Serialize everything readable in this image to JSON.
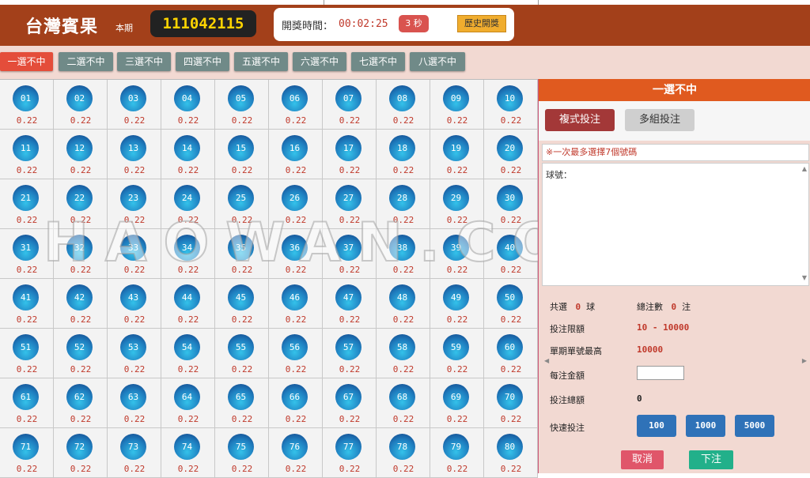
{
  "header": {
    "title": "台灣賓果",
    "period_label": "本期",
    "period_number": "111042115",
    "draw_time_label": "開獎時間：",
    "draw_time_value": "00:02:25",
    "countdown_label": "3 秒",
    "history_label": "歷史開獎"
  },
  "tabs": [
    "一選不中",
    "二選不中",
    "三選不中",
    "四選不中",
    "五選不中",
    "六選不中",
    "七選不中",
    "八選不中"
  ],
  "active_tab": 0,
  "grid": {
    "numbers": [
      "01",
      "02",
      "03",
      "04",
      "05",
      "06",
      "07",
      "08",
      "09",
      "10",
      "11",
      "12",
      "13",
      "14",
      "15",
      "16",
      "17",
      "18",
      "19",
      "20",
      "21",
      "22",
      "23",
      "24",
      "25",
      "26",
      "27",
      "28",
      "29",
      "30",
      "31",
      "32",
      "33",
      "34",
      "35",
      "36",
      "37",
      "38",
      "39",
      "40",
      "41",
      "42",
      "43",
      "44",
      "45",
      "46",
      "47",
      "48",
      "49",
      "50",
      "51",
      "52",
      "53",
      "54",
      "55",
      "56",
      "57",
      "58",
      "59",
      "60",
      "61",
      "62",
      "63",
      "64",
      "65",
      "66",
      "67",
      "68",
      "69",
      "70",
      "71",
      "72",
      "73",
      "74",
      "75",
      "76",
      "77",
      "78",
      "79",
      "80"
    ],
    "odds": "0.22"
  },
  "watermark": "HAOWAN.COM.TW",
  "panel": {
    "title": "一選不中",
    "mode_single": "複式投注",
    "mode_multi": "多組投注",
    "notice": "※一次最多選擇7個號碼",
    "balls_label": "球號：",
    "selected_prefix": "共選",
    "selected_count": "0",
    "selected_suffix": "球",
    "total_bets_prefix": "總注數",
    "total_bets_count": "0",
    "total_bets_suffix": "注",
    "limit_label": "投注限額",
    "limit_value": "10 - 10000",
    "max_label": "單期單號最高",
    "max_value": "10000",
    "amount_label": "每注金額",
    "amount_value": "",
    "total_label": "投注總額",
    "total_value": "0",
    "quick_label": "快速投注",
    "quick_amounts": [
      "100",
      "1000",
      "5000"
    ],
    "cancel_label": "取消",
    "submit_label": "下注"
  }
}
